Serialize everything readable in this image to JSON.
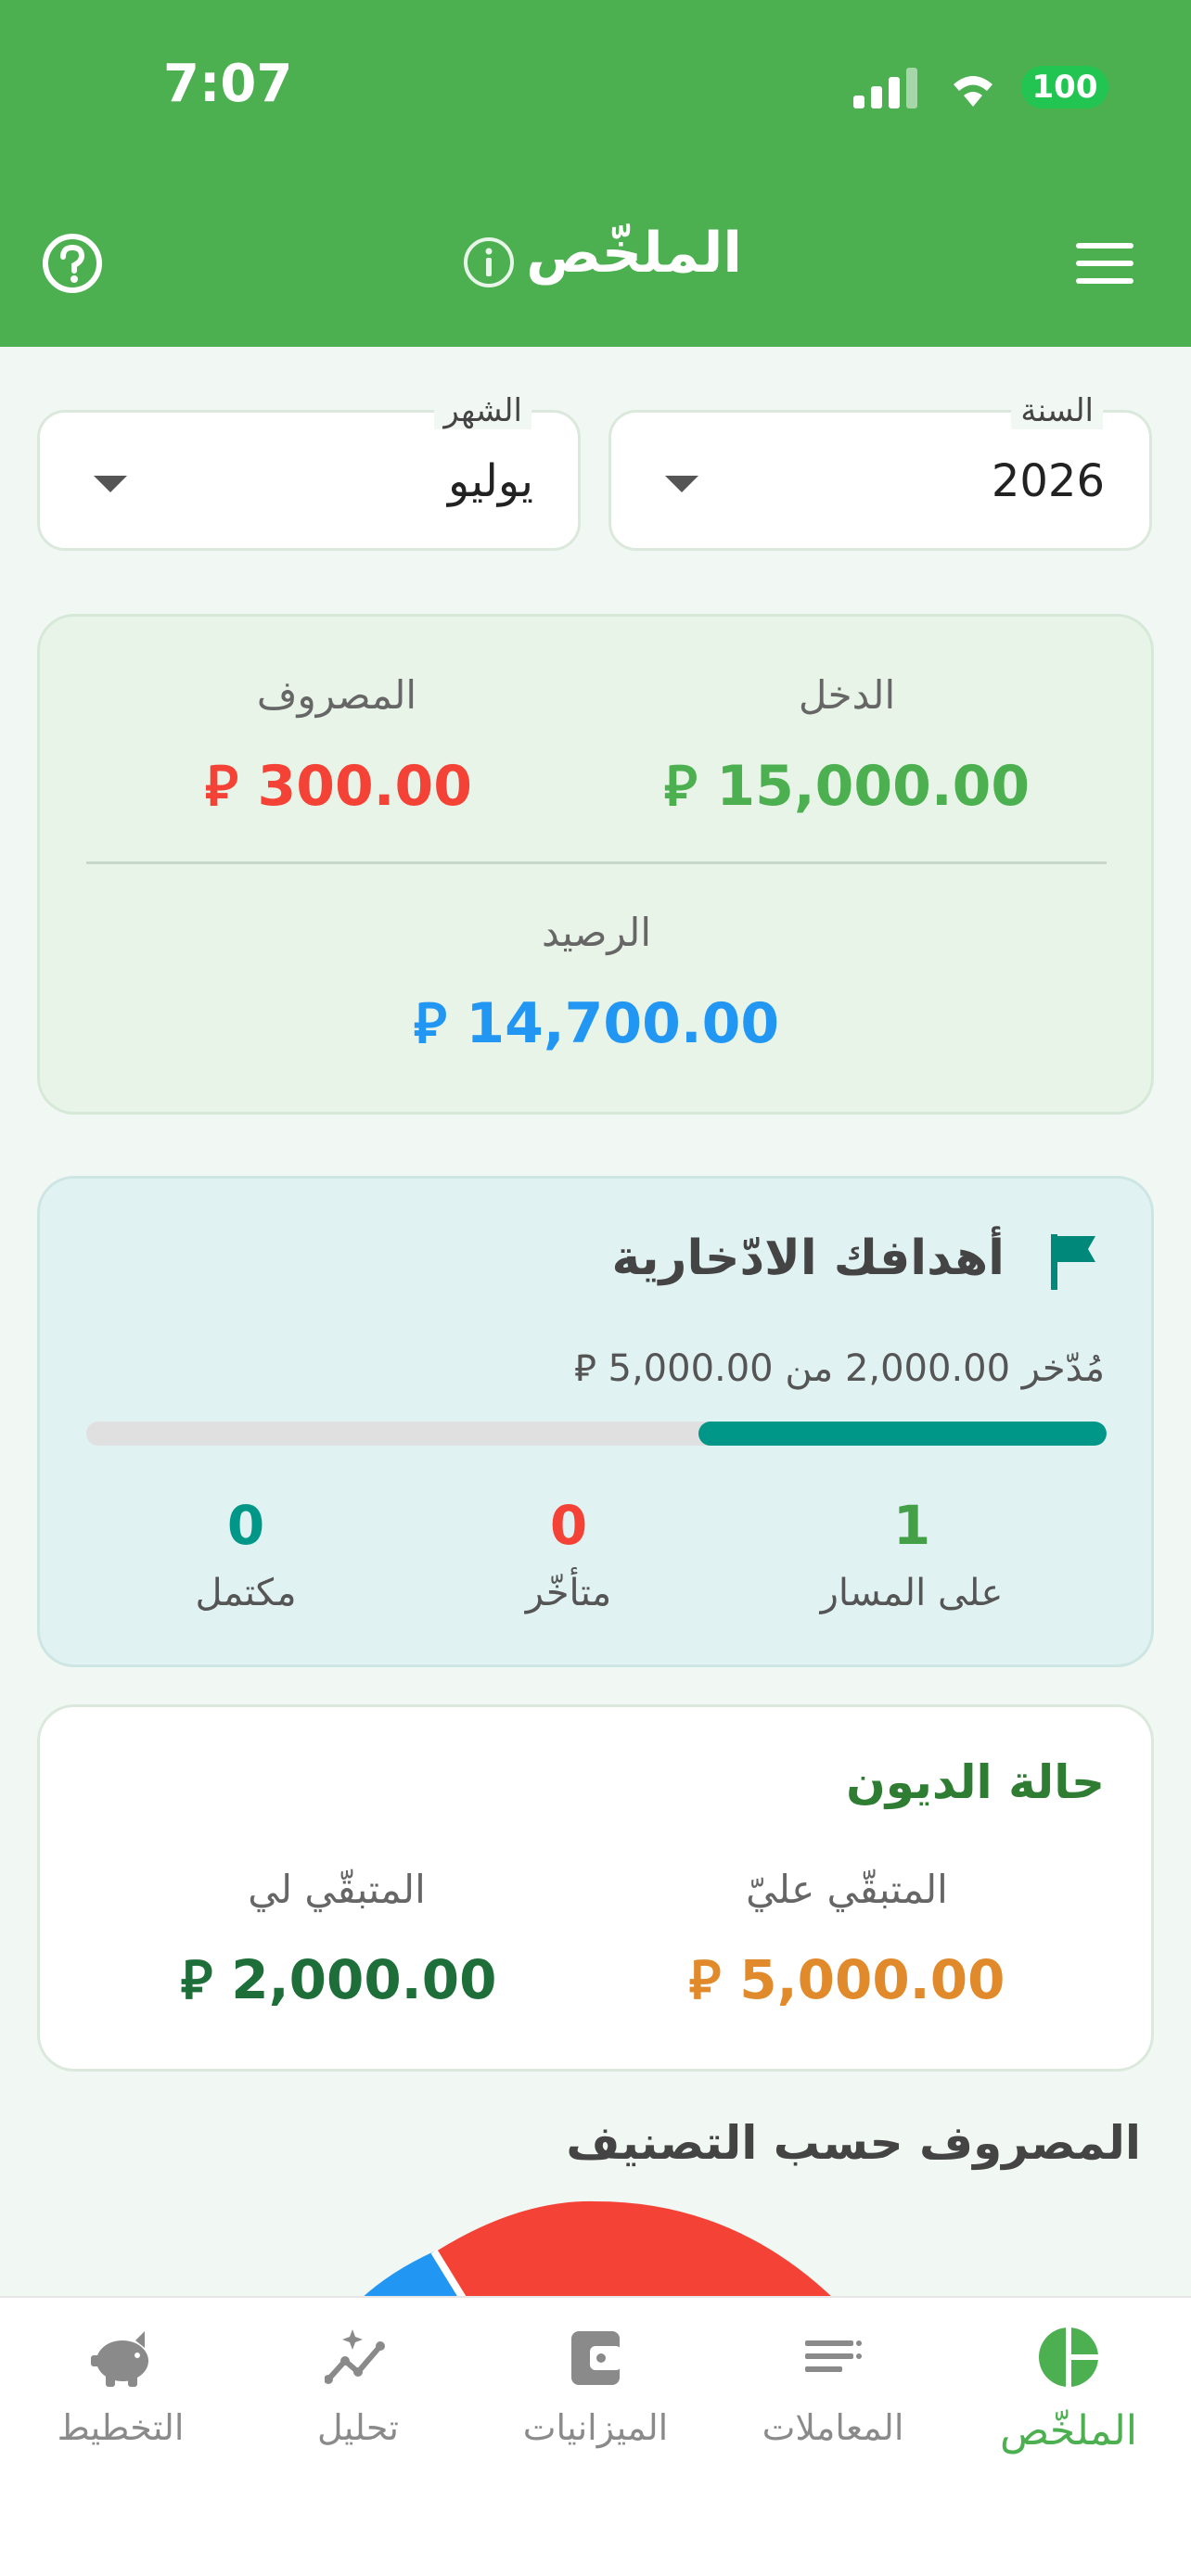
{
  "status_bar": {
    "time": "7:07",
    "battery": "100"
  },
  "header": {
    "title": "الملخّص"
  },
  "filters": {
    "year": {
      "label": "السنة",
      "value": "2026"
    },
    "month": {
      "label": "الشهر",
      "value": "يوليو"
    }
  },
  "summary": {
    "income_label": "الدخل",
    "income_value": "15,000.00",
    "expense_label": "المصروف",
    "expense_value": "300.00",
    "balance_label": "الرصيد",
    "balance_value": "14,700.00",
    "currency_symbol": "⃁"
  },
  "savings_goals": {
    "title": "أهدافك الادّخارية",
    "progress_text": "مُدّخر 2,000.00 من 5,000.00 ⃁",
    "progress_fraction": 0.4,
    "on_track_label": "على المسار",
    "on_track_value": "1",
    "late_label": "متأخّر",
    "late_value": "0",
    "completed_label": "مكتمل",
    "completed_value": "0"
  },
  "debts": {
    "title": "حالة الديون",
    "owed_by_me_label": "المتبقّي عليّ",
    "owed_by_me_value": "5,000.00",
    "owed_to_me_label": "المتبقّي لي",
    "owed_to_me_value": "2,000.00"
  },
  "expenses_by_category": {
    "title": "المصروف حسب التصنيف"
  },
  "bottom_nav": {
    "summary": "الملخّص",
    "transactions": "المعاملات",
    "budgets": "الميزانيات",
    "analysis": "تحليل",
    "planning": "التخطيط"
  },
  "colors": {
    "primary": "#4caf50",
    "income": "#4caf50",
    "expense": "#f44336",
    "balance": "#2196f3",
    "goals": "#009688",
    "owed_by_me": "#e08a2c",
    "owed_to_me": "#1e6e3a"
  }
}
